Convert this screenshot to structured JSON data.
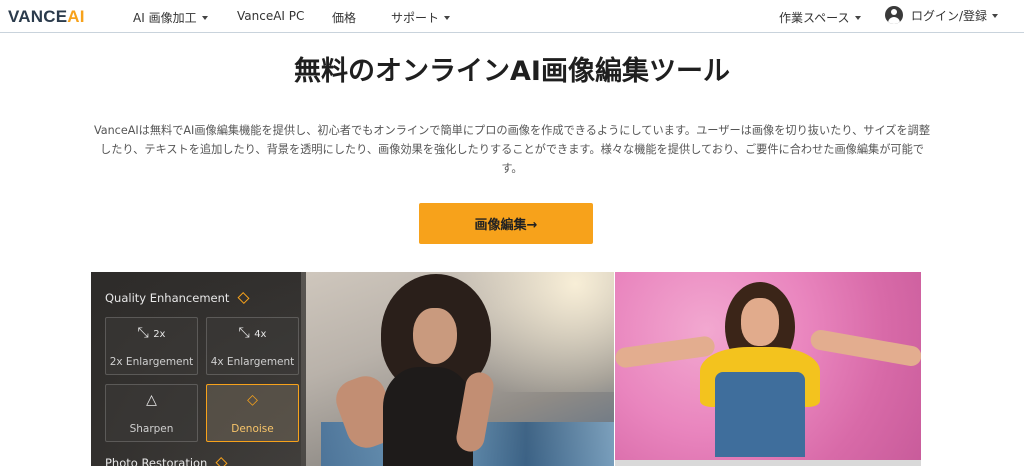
{
  "header": {
    "logo": {
      "main": "VANCE",
      "accent": "AI"
    },
    "nav": [
      {
        "label": "AI 画像加工",
        "dropdown": true
      },
      {
        "label": "VanceAI PC",
        "dropdown": false
      },
      {
        "label": "価格",
        "dropdown": false
      },
      {
        "label": "サポート",
        "dropdown": true
      }
    ],
    "workspace": {
      "label": "作業スペース",
      "dropdown": true
    },
    "account": {
      "label": "ログイン/登録",
      "dropdown": true,
      "icon": "user-circle-icon"
    }
  },
  "hero": {
    "title": "無料のオンラインAI画像編集ツール",
    "description_lines": [
      "VanceAIは無料でAI画像編集機能を提供し、初心者でもオンラインで簡単にプロの画像を作成できるようにしています。ユーザーは画像を切り抜いたり、サイズを調整",
      "したり、テキストを追加したり、背景を透明にしたり、画像効果を強化したりすることができます。様々な機能を提供しており、ご要件に合わせた画像編集が可能で",
      "す。"
    ],
    "cta_label": "画像編集→"
  },
  "showcase": {
    "panel_title": "Quality Enhancement",
    "tools": [
      {
        "label": "2x Enlargement",
        "icon_text": "2x",
        "icon": "expand-arrows-icon",
        "active": false
      },
      {
        "label": "4x Enlargement",
        "icon_text": "4x",
        "icon": "expand-arrows-icon",
        "active": false
      },
      {
        "label": "Sharpen",
        "icon": "sharpen-triangle-icon",
        "active": false
      },
      {
        "label": "Denoise",
        "icon": "eraser-icon",
        "active": true
      }
    ],
    "next_section": "Photo Restoration"
  },
  "colors": {
    "accent": "#f7a21b",
    "text_dark": "#1f1f1f",
    "text_body": "#555555"
  }
}
